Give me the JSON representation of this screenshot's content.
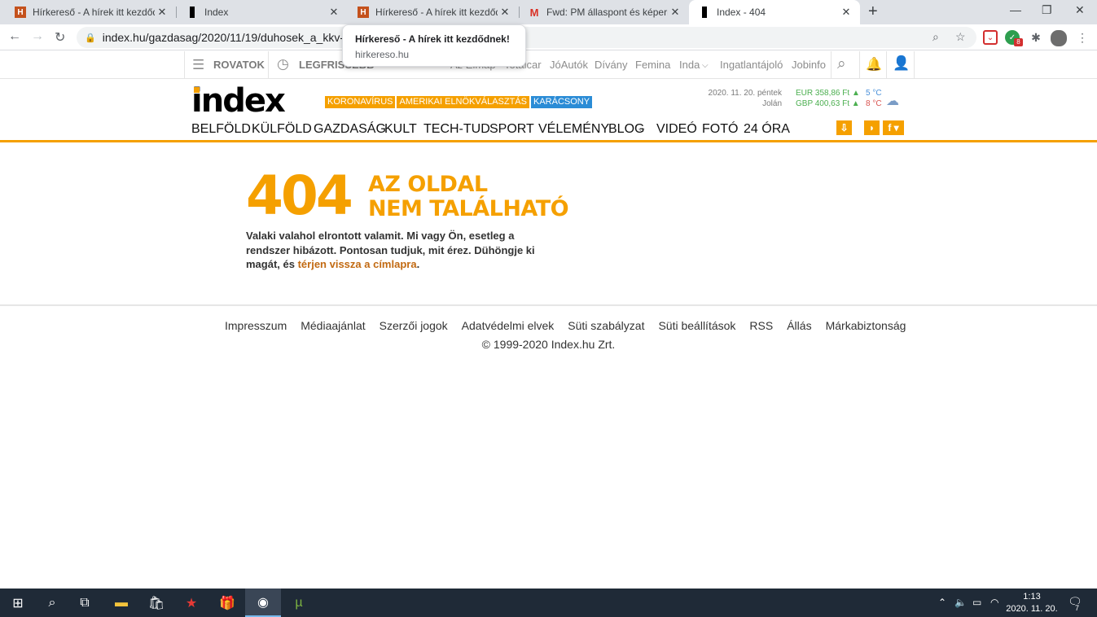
{
  "browser": {
    "tabs": [
      {
        "title": "Hírkereső - A hírek itt kezdődnek!",
        "favicon": "H"
      },
      {
        "title": "Index",
        "favicon": ""
      },
      {
        "title": "Hírkereső - A hírek itt kezdődnek!",
        "favicon": "H"
      },
      {
        "title": "Fwd: PM állaspont és képernyőkép",
        "favicon": "M"
      },
      {
        "title": "Index - 404",
        "favicon": ""
      }
    ],
    "url": "index.hu/gazdasag/2020/11/19/duhosek_a_kkv-k_alig_",
    "tooltip_title": "Hírkereső - A hírek itt kezdődnek!",
    "tooltip_host": "hirkereso.hu",
    "ext_badge": "8"
  },
  "sitebar": {
    "rovatok": "ROVATOK",
    "legfrissebb": "LEGFRISSEBB",
    "links": [
      "Totalcar",
      "JóAutók",
      "Dívány",
      "Femina",
      "Inda",
      "Ingatlantájoló",
      "Jobinfo"
    ],
    "partial": "Az Eimap"
  },
  "header": {
    "logo": "index",
    "tags": [
      "KORONAVÍRUS",
      "AMERIKAI ELNÖKVÁLASZTÁS",
      "KARÁCSONY"
    ],
    "date": "2020. 11. 20. péntek",
    "nameday": "Jolán",
    "eur": "EUR 358,86 Ft",
    "gbp": "GBP 400,63 Ft",
    "temp_low": "5 °C",
    "temp_high": "8 °C"
  },
  "nav": [
    "BELFÖLD",
    "KÜLFÖLD",
    "GAZDASÁG",
    "KULT",
    "TECH-TUD",
    "SPORT",
    "VÉLEMÉNY",
    "BLOG",
    "VIDEÓ",
    "FOTÓ",
    "24 ÓRA"
  ],
  "error": {
    "code": "404",
    "line1": "AZ OLDAL",
    "line2": "NEM TALÁLHATÓ",
    "message": "Valaki valahol elrontott valamit. Mi vagy Ön, esetleg a rendszer hibázott. Pontosan tudjuk, mit érez. Dühöngje ki magát, és ",
    "link": "térjen vissza a címlapra",
    "end": "."
  },
  "footer": {
    "links": [
      "Impresszum",
      "Médiaajánlat",
      "Szerzői jogok",
      "Adatvédelmi elvek",
      "Süti szabályzat",
      "Süti beállítások",
      "RSS",
      "Állás",
      "Márkabiztonság"
    ],
    "copyright": "© 1999-2020 Index.hu Zrt."
  },
  "taskbar": {
    "time": "1:13",
    "date": "2020. 11. 20.",
    "notif_count": "7"
  },
  "colors": {
    "accent": "#f5a000",
    "link": "#c26a12",
    "tag_blue": "#2b8cd6"
  }
}
